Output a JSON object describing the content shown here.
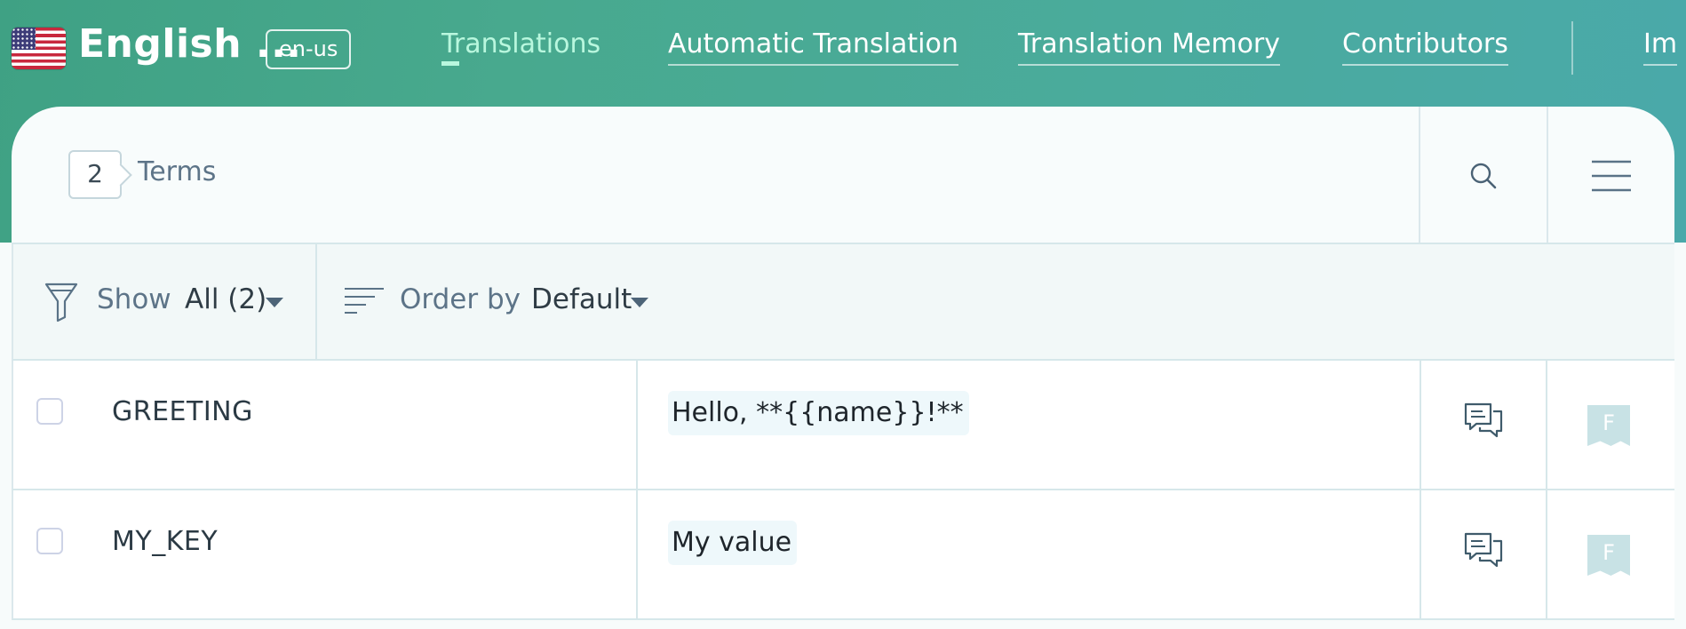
{
  "language": {
    "name": "English ...",
    "code": "en-us",
    "flag_icon": "us-flag-icon"
  },
  "nav": {
    "tabs": [
      {
        "label": "Translations",
        "active": true
      },
      {
        "label": "Automatic Translation",
        "active": false
      },
      {
        "label": "Translation Memory",
        "active": false
      },
      {
        "label": "Contributors",
        "active": false
      }
    ],
    "overflow_label": "Im"
  },
  "header": {
    "terms_count": "2",
    "terms_label": "Terms",
    "search_icon": "search-icon",
    "menu_icon": "hamburger-menu-icon"
  },
  "toolbar": {
    "filter_label": "Show",
    "filter_value": "All (2)",
    "order_label": "Order by",
    "order_value": "Default"
  },
  "rows": [
    {
      "key": "GREETING",
      "value": "Hello, **{{name}}!**",
      "badge": "F"
    },
    {
      "key": "MY_KEY",
      "value": "My value",
      "badge": "F"
    }
  ],
  "colors": {
    "accent": "#4aab9c",
    "active_tab": "#b9f7de",
    "text_muted": "#5d7488"
  }
}
